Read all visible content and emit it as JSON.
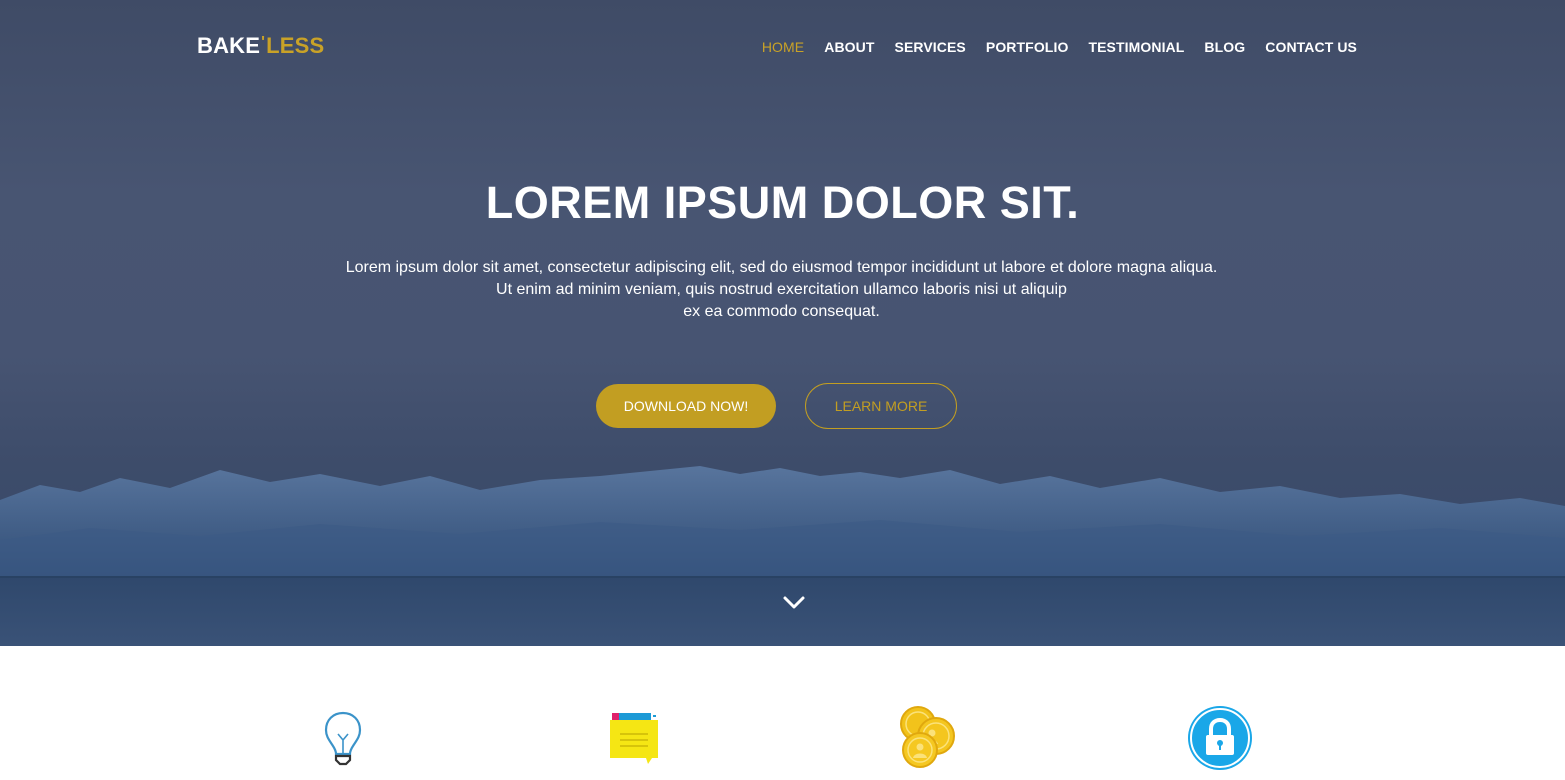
{
  "brand": {
    "part1": "BAKE",
    "separator": "'",
    "part2": "LESS"
  },
  "nav": {
    "items": [
      {
        "label": "HOME",
        "active": true
      },
      {
        "label": "ABOUT",
        "active": false
      },
      {
        "label": "SERVICES",
        "active": false
      },
      {
        "label": "PORTFOLIO",
        "active": false
      },
      {
        "label": "TESTIMONIAL",
        "active": false
      },
      {
        "label": "BLOG",
        "active": false
      },
      {
        "label": "CONTACT US",
        "active": false
      }
    ]
  },
  "hero": {
    "title": "LOREM IPSUM DOLOR SIT.",
    "description_lines": [
      "Lorem ipsum dolor sit amet, consectetur adipiscing elit, sed do eiusmod tempor incididunt ut labore et dolore magna aliqua.",
      "Ut enim ad minim veniam, quis nostrud exercitation ullamco laboris nisi ut aliquip",
      "ex ea commodo consequat."
    ],
    "primary_button": "DOWNLOAD NOW!",
    "secondary_button": "LEARN MORE",
    "scroll_icon": "chevron-down-icon"
  },
  "features": {
    "icons": [
      "lightbulb-icon",
      "notepad-icon",
      "gold-coins-icon",
      "padlock-icon"
    ]
  },
  "colors": {
    "accent": "#c29e22",
    "hero_overlay": "#475472",
    "lock_blue": "#1aa7e8"
  }
}
